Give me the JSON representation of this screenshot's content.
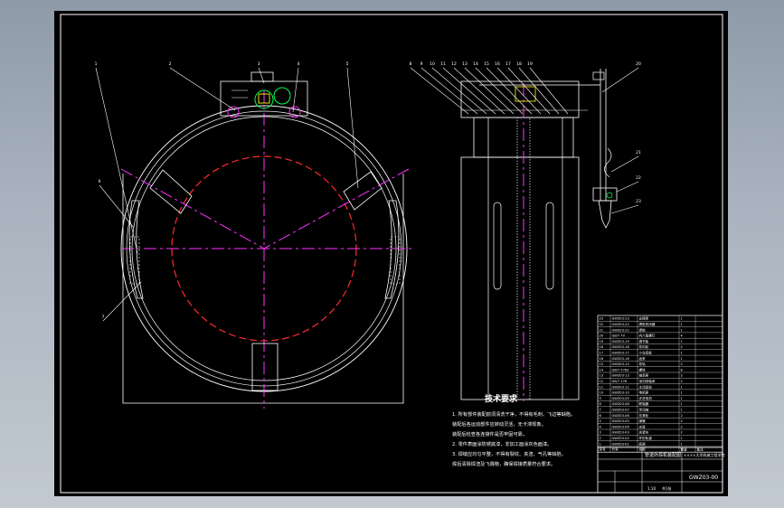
{
  "drawing": {
    "tech_requirements_title": "技术要求",
    "tech_requirements": [
      "1. 所有部件装配前须清洗干净，不得有毛刺、飞边等缺陷。",
      "   装配后各运动部件应转动灵活，无卡滞现象。",
      "   装配后检查各连接件是否牢固可靠。",
      "2. 零件表面涂防锈底漆，非加工面涂灰色面漆。",
      "3. 焊缝应均匀平整，不得有裂纹、夹渣、气孔等缺陷，",
      "   焊后清除焊渣及飞溅物，确保焊接质量符合要求。"
    ],
    "drawing_title": "管道外焊机装配图",
    "drawing_number": "GWZ03-00",
    "scale_label": "1:10",
    "sheet_label": "共1张",
    "company": "××××大学机械工程学院",
    "bom_header": [
      "序号",
      "代号",
      "名称",
      "数量",
      "备注"
    ],
    "bom_rows": [
      [
        "23",
        "GWZ03-23",
        "支撑架",
        "1",
        ""
      ],
      [
        "22",
        "GWZ03-22",
        "焊枪夹持器",
        "1",
        ""
      ],
      [
        "21",
        "GWZ03-21",
        "焊枪",
        "1",
        ""
      ],
      [
        "20",
        "GB/T 70",
        "内六角螺钉",
        "4",
        ""
      ],
      [
        "19",
        "GWZ03-19",
        "调节板",
        "1",
        ""
      ],
      [
        "18",
        "GWZ03-18",
        "导向轮",
        "2",
        ""
      ],
      [
        "17",
        "GWZ03-17",
        "小车底板",
        "1",
        ""
      ],
      [
        "16",
        "GWZ03-16",
        "齿条",
        "1",
        ""
      ],
      [
        "15",
        "GWZ03-15",
        "导轨",
        "2",
        ""
      ],
      [
        "14",
        "GB/T 5783",
        "螺栓",
        "8",
        ""
      ],
      [
        "13",
        "GWZ03-13",
        "轴承座",
        "2",
        ""
      ],
      [
        "12",
        "GB/T 276",
        "深沟球轴承",
        "2",
        ""
      ],
      [
        "11",
        "GWZ03-11",
        "主动齿轮",
        "1",
        ""
      ],
      [
        "10",
        "GWZ03-10",
        "电机座",
        "1",
        ""
      ],
      [
        "9",
        "GWZ03-09",
        "步进电机",
        "1",
        ""
      ],
      [
        "8",
        "GWZ03-08",
        "联轴器",
        "1",
        ""
      ],
      [
        "7",
        "GWZ03-07",
        "传动轴",
        "1",
        ""
      ],
      [
        "6",
        "GWZ03-06",
        "压紧轮",
        "2",
        ""
      ],
      [
        "5",
        "GWZ03-05",
        "弹簧",
        "2",
        ""
      ],
      [
        "4",
        "GWZ03-04",
        "支臂",
        "2",
        ""
      ],
      [
        "3",
        "GWZ03-03",
        "夹紧块",
        "2",
        ""
      ],
      [
        "2",
        "GWZ03-02",
        "环形轨道",
        "1",
        ""
      ],
      [
        "1",
        "GWZ03-01",
        "底座",
        "1",
        ""
      ]
    ],
    "balloons_front": [
      "1",
      "2",
      "3",
      "4",
      "5",
      "6",
      "7"
    ],
    "balloons_side_top": [
      "8",
      "9",
      "10",
      "11",
      "12",
      "13",
      "14",
      "15",
      "16",
      "17",
      "18",
      "19"
    ],
    "balloons_side_right": [
      "20",
      "21",
      "22",
      "23"
    ]
  }
}
